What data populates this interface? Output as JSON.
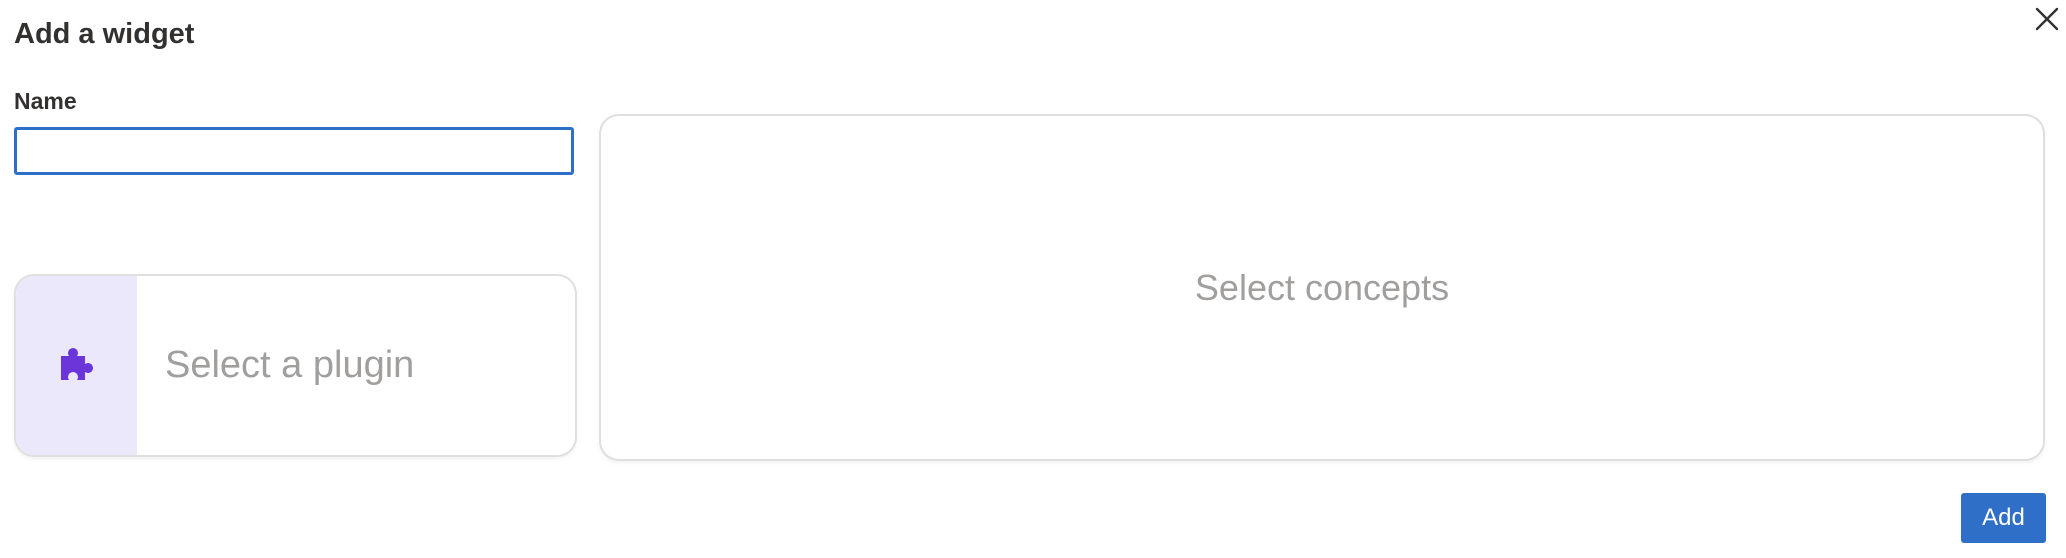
{
  "dialog": {
    "title": "Add a widget",
    "close_icon": "close-icon"
  },
  "form": {
    "name_label": "Name",
    "name_value": "",
    "name_placeholder": ""
  },
  "plugin": {
    "icon": "puzzle-piece-icon",
    "icon_color": "#6a35d9",
    "icon_background": "#ece8fb",
    "label": "Select a plugin"
  },
  "concepts": {
    "label": "Select concepts"
  },
  "actions": {
    "add_label": "Add",
    "accent_color": "#2f6fc7"
  }
}
